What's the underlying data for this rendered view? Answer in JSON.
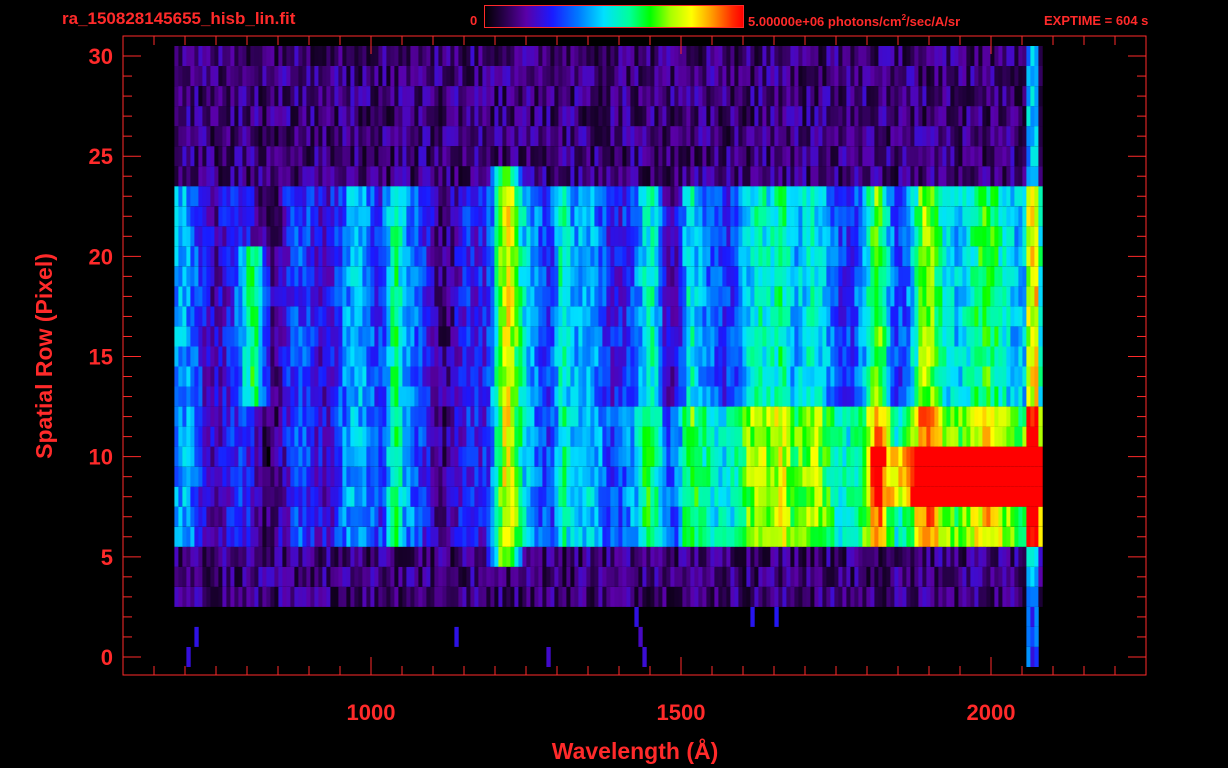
{
  "header": {
    "file_title": "ra_150828145655_hisb_lin.fit",
    "colorbar_min": "0",
    "colorbar_max": "5.00000e+06 photons/cm",
    "colorbar_max_sup": "2",
    "colorbar_max_suffix": "/sec/A/sr",
    "exptime": "EXPTIME = 604 s"
  },
  "colors": {
    "axis": "#ff2a2a",
    "background": "#000000",
    "colormap": [
      "#000000",
      "#5a00a8",
      "#1a1aff",
      "#00e0ff",
      "#00ff00",
      "#ffff00",
      "#ff0000"
    ]
  },
  "chart_data": {
    "type": "heatmap",
    "title": "ra_150828145655_hisb_lin.fit",
    "xlabel": "Wavelength (Å)",
    "ylabel": "Spatial Row (Pixel)",
    "xlim": [
      600,
      2250
    ],
    "ylim": [
      -0.9,
      31
    ],
    "x_ticks": [
      1000,
      1500,
      2000
    ],
    "y_ticks": [
      0,
      5,
      10,
      15,
      20,
      25,
      30
    ],
    "colorbar": {
      "min": 0,
      "max": 5000000,
      "unit": "photons/cm^2/sec/A/sr"
    },
    "exposure_time_s": 604,
    "grid": false
  }
}
